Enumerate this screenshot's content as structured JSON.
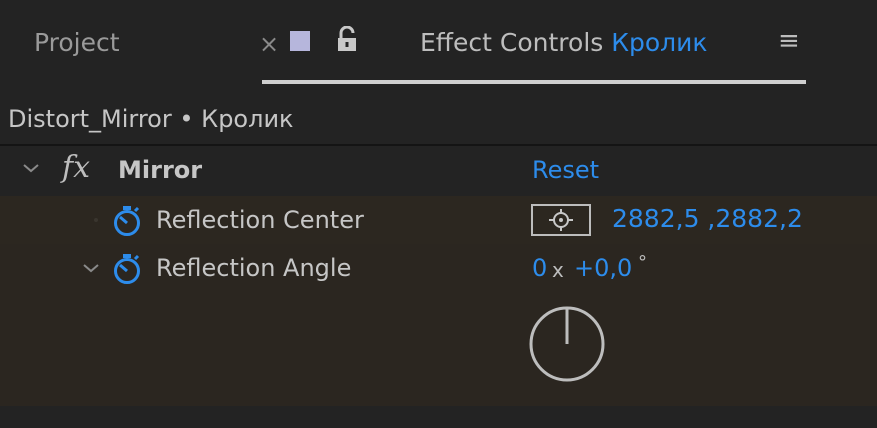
{
  "tabs": {
    "project_label": "Project",
    "close_symbol": "×",
    "effect_controls_label": "Effect Controls",
    "layer_name": "Кролик",
    "menu_symbol": "≡"
  },
  "comp_line": {
    "text": "Distort_Mirror • Кролик"
  },
  "effect": {
    "name": "Mirror",
    "fx_symbol": "fx",
    "reset_label": "Reset",
    "chevron": "⌄"
  },
  "properties": {
    "reflection_center": {
      "label": "Reflection Center",
      "value": "2882,5 ,2882,2"
    },
    "reflection_angle": {
      "label": "Reflection Angle",
      "revolutions": "0",
      "x_sep": "x",
      "degrees": "+0,0",
      "unit": "°"
    }
  },
  "colors": {
    "accent_blue": "#2d8ceb",
    "panel_bg": "#232323",
    "row_bg": "#2c2720",
    "swatch": "#b6b6dc"
  },
  "icons": [
    "lock-icon",
    "stopwatch-icon",
    "target-icon",
    "angle-dial-icon",
    "menu-icon",
    "fx-icon"
  ]
}
